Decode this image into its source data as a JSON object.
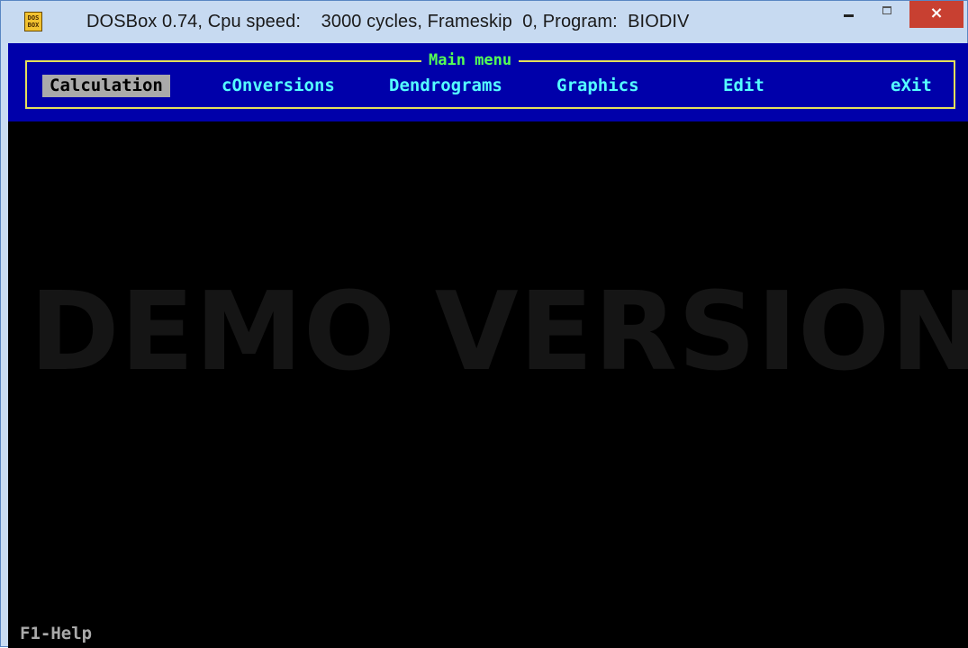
{
  "window": {
    "app_icon_label": "DOS BOX",
    "title": "DOSBox 0.74, Cpu speed:    3000 cycles, Frameskip  0, Program:  BIODIV",
    "minimize_icon": "minimize-icon",
    "maximize_icon": "maximize-icon",
    "close_icon": "close-icon",
    "close_glyph": "×"
  },
  "main_menu": {
    "title": "Main menu",
    "selected_index": 0,
    "items": [
      {
        "label": "Calculation"
      },
      {
        "label": "cOnversions"
      },
      {
        "label": "Dendrograms"
      },
      {
        "label": "Graphics"
      },
      {
        "label": "Edit"
      },
      {
        "label": "eXit"
      }
    ]
  },
  "watermark": "DEMO VERSION",
  "status_bar": {
    "help": "F1-Help"
  },
  "colors": {
    "titlebar": "#c7daf1",
    "close_button": "#c84031",
    "menu_panel": "#0000aa",
    "menu_frame": "#e5e05a",
    "menu_title": "#55ff55",
    "menu_item": "#55ffff",
    "menu_selected_bg": "#aaaaaa",
    "screen_bg": "#000000",
    "watermark": "#151515"
  }
}
